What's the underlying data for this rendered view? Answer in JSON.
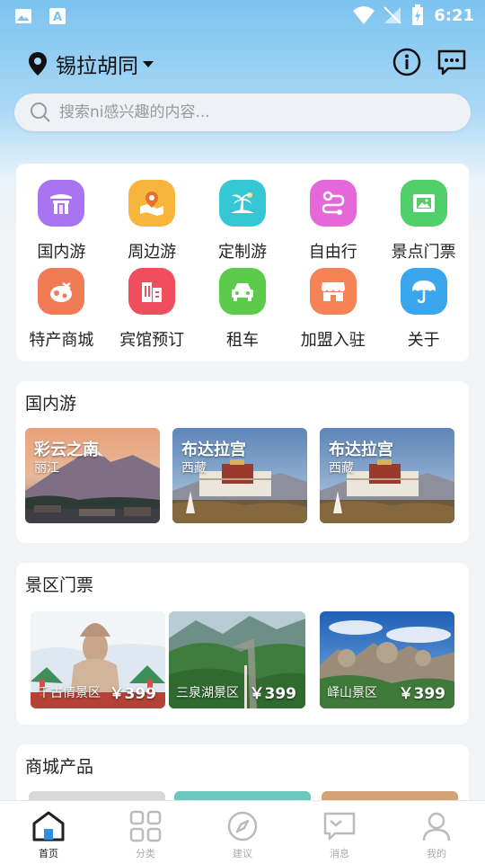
{
  "status_bar": {
    "time": "6:21"
  },
  "header": {
    "location": "锡拉胡同"
  },
  "search": {
    "placeholder": "搜索ni感兴趣的内容..."
  },
  "categories": [
    {
      "label": "国内游",
      "icon": "temple-icon",
      "color": "#a874f0"
    },
    {
      "label": "周边游",
      "icon": "map-pin-icon",
      "color": "#f7b53c"
    },
    {
      "label": "定制游",
      "icon": "palm-island-icon",
      "color": "#35c8d4"
    },
    {
      "label": "自由行",
      "icon": "route-icon",
      "color": "#e468d9"
    },
    {
      "label": "景点门票",
      "icon": "ticket-icon",
      "color": "#50cf6a"
    },
    {
      "label": "特产商城",
      "icon": "specialty-icon",
      "color": "#f07b55"
    },
    {
      "label": "宾馆预订",
      "icon": "hotel-icon",
      "color": "#ef4f5d"
    },
    {
      "label": "租车",
      "icon": "car-icon",
      "color": "#5ccb4c"
    },
    {
      "label": "加盟入驻",
      "icon": "store-icon",
      "color": "#f68355"
    },
    {
      "label": "关于",
      "icon": "umbrella-icon",
      "color": "#3aa6ee"
    }
  ],
  "domestic": {
    "title": "国内游",
    "items": [
      {
        "title": "彩云之南",
        "subtitle": "丽江"
      },
      {
        "title": "布达拉宫",
        "subtitle": "西藏"
      },
      {
        "title": "布达拉宫",
        "subtitle": "西藏"
      }
    ]
  },
  "tickets": {
    "title": "景区门票",
    "items": [
      {
        "name": "千古情景区",
        "price": "￥399"
      },
      {
        "name": "三泉湖景区",
        "price": "￥399"
      },
      {
        "name": "峄山景区",
        "price": "￥399"
      }
    ]
  },
  "mall": {
    "title": "商城产品"
  },
  "tabs": [
    {
      "label": "首页",
      "icon": "home-icon",
      "active": true
    },
    {
      "label": "分类",
      "icon": "grid-icon",
      "active": false
    },
    {
      "label": "建议",
      "icon": "compass-icon",
      "active": false
    },
    {
      "label": "消息",
      "icon": "message-icon",
      "active": false
    },
    {
      "label": "我的",
      "icon": "user-icon",
      "active": false
    }
  ]
}
